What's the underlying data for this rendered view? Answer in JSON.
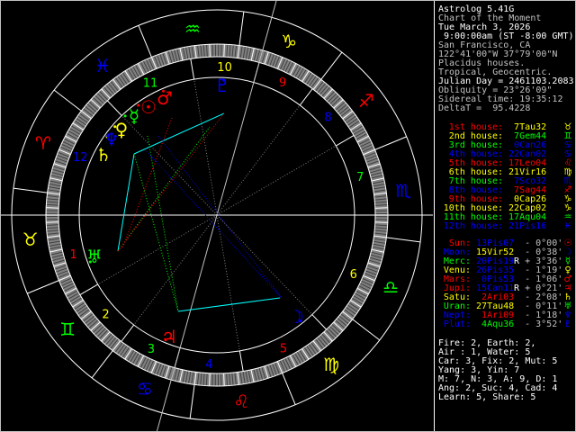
{
  "info": {
    "app_title": "Astrolog 5.41G",
    "chart_name": "Chart of the Moment",
    "date": "Tue March 3, 2026",
    "time": " 9:00:00am (ST -8:00 GMT)",
    "location": "San Francisco, CA",
    "coords": "122°41'00\"W 37°79'00\"N",
    "house_system": "Placidus houses.",
    "zodiac": "Tropical, Geocentric.",
    "julian_day": "Julian Day = 2461103.2083",
    "obliquity": "Obliquity = 23°26'09\"",
    "sidereal": "Sidereal time: 19:35:12",
    "deltat": "DeltaT =  95.4228"
  },
  "colors": {
    "fire": "#ff0000",
    "earth": "#ffff00",
    "air": "#00ff00",
    "water": "#0000ff",
    "text": "#c0c0c0",
    "white": "#ffffff",
    "aspect_cyan": "#00ffff",
    "gray": "#808080"
  },
  "houses": [
    {
      "label": "1st house:",
      "pos": " 7Tau32",
      "lcolor": "#ff0000",
      "pcolor": "#ffff00",
      "glyph": "♉"
    },
    {
      "label": "2nd house:",
      "pos": " 7Gem44",
      "lcolor": "#ffff00",
      "pcolor": "#00ff00",
      "glyph": "♊"
    },
    {
      "label": "3rd house:",
      "pos": " 0Can26",
      "lcolor": "#00ff00",
      "pcolor": "#0000ff",
      "glyph": "♋"
    },
    {
      "label": "4th house:",
      "pos": "22Can02",
      "lcolor": "#0000ff",
      "pcolor": "#0000ff",
      "glyph": "♋"
    },
    {
      "label": "5th house:",
      "pos": "17Leo04",
      "lcolor": "#ff0000",
      "pcolor": "#ff0000",
      "glyph": "♌"
    },
    {
      "label": "6th house:",
      "pos": "21Vir16",
      "lcolor": "#ffff00",
      "pcolor": "#ffff00",
      "glyph": "♍"
    },
    {
      "label": "7th house:",
      "pos": " 7Sco32",
      "lcolor": "#00ff00",
      "pcolor": "#0000ff",
      "glyph": "♏"
    },
    {
      "label": "8th house:",
      "pos": " 7Sag44",
      "lcolor": "#0000ff",
      "pcolor": "#ff0000",
      "glyph": "♐"
    },
    {
      "label": "9th house:",
      "pos": " 0Cap26",
      "lcolor": "#ff0000",
      "pcolor": "#ffff00",
      "glyph": "♑"
    },
    {
      "label": "10th house:",
      "pos": "22Cap02",
      "lcolor": "#ffff00",
      "pcolor": "#ffff00",
      "glyph": "♑"
    },
    {
      "label": "11th house:",
      "pos": "17Aqu04",
      "lcolor": "#00ff00",
      "pcolor": "#00ff00",
      "glyph": "♒"
    },
    {
      "label": "12th house:",
      "pos": "21Pis16",
      "lcolor": "#0000ff",
      "pcolor": "#0000ff",
      "glyph": "♓"
    }
  ],
  "planets": [
    {
      "name": "Sun:",
      "pos": "13Pis07",
      "retro": " ",
      "delta": "- 0°00'",
      "lcolor": "#ff0000",
      "pcolor": "#0000ff",
      "glyph": "☉",
      "lon": 343.12
    },
    {
      "name": "Moon:",
      "pos": "15Vir52",
      "retro": " ",
      "delta": "- 0°38'",
      "lcolor": "#0000ff",
      "pcolor": "#ffff00",
      "glyph": "☽",
      "lon": 165.87
    },
    {
      "name": "Merc:",
      "pos": "20Pis19",
      "retro": "R",
      "delta": "+ 3°36'",
      "lcolor": "#00ff00",
      "pcolor": "#0000ff",
      "glyph": "☿",
      "lon": 350.32
    },
    {
      "name": "Venu:",
      "pos": "26Pis35",
      "retro": " ",
      "delta": "- 1°19'",
      "lcolor": "#ffff00",
      "pcolor": "#0000ff",
      "glyph": "♀",
      "lon": 356.58
    },
    {
      "name": "Mars:",
      "pos": " 0Pis53",
      "retro": " ",
      "delta": "- 1°06'",
      "lcolor": "#ff0000",
      "pcolor": "#0000ff",
      "glyph": "♂",
      "lon": 330.88
    },
    {
      "name": "Jupi:",
      "pos": "15Can11",
      "retro": "R",
      "delta": "+ 0°21'",
      "lcolor": "#ff0000",
      "pcolor": "#0000ff",
      "glyph": "♃",
      "lon": 105.18
    },
    {
      "name": "Satu:",
      "pos": " 2Ari03",
      "retro": " ",
      "delta": "- 2°08'",
      "lcolor": "#ffff00",
      "pcolor": "#ff0000",
      "glyph": "♄",
      "lon": 2.05
    },
    {
      "name": "Uran:",
      "pos": "27Tau48",
      "retro": " ",
      "delta": "- 0°11'",
      "lcolor": "#00ff00",
      "pcolor": "#ffff00",
      "glyph": "♅",
      "lon": 57.8
    },
    {
      "name": "Nept:",
      "pos": " 1Ari09",
      "retro": " ",
      "delta": "- 1°18'",
      "lcolor": "#0000ff",
      "pcolor": "#ff0000",
      "glyph": "♆",
      "lon": 1.15
    },
    {
      "name": "Plut:",
      "pos": " 4Aqu36",
      "retro": " ",
      "delta": "- 3°52'",
      "lcolor": "#0000ff",
      "pcolor": "#00ff00",
      "glyph": "♇",
      "lon": 304.6
    }
  ],
  "summary": [
    "Fire: 2, Earth: 2,",
    "Air : 1, Water: 5",
    "Car: 3, Fix: 2, Mut: 5",
    "Yang: 3, Yin: 7",
    "M: 7, N: 3, A: 9, D: 1",
    "Ang: 2, Suc: 4, Cad: 4",
    "Learn: 5, Share: 5"
  ],
  "wheel": {
    "ascendant_lon": 37.53,
    "cusps": [
      37.53,
      67.73,
      90.43,
      112.03,
      137.07,
      171.27,
      217.53,
      247.73,
      270.43,
      292.03,
      317.07,
      351.27
    ],
    "house_numbers": [
      "1",
      "2",
      "3",
      "4",
      "5",
      "6",
      "7",
      "8",
      "9",
      "10",
      "11",
      "12"
    ],
    "signs": [
      {
        "glyph": "♈",
        "color": "#ff0000"
      },
      {
        "glyph": "♉",
        "color": "#ffff00"
      },
      {
        "glyph": "♊",
        "color": "#00ff00"
      },
      {
        "glyph": "♋",
        "color": "#0000ff"
      },
      {
        "glyph": "♌",
        "color": "#ff0000"
      },
      {
        "glyph": "♍",
        "color": "#ffff00"
      },
      {
        "glyph": "♎",
        "color": "#00ff00"
      },
      {
        "glyph": "♏",
        "color": "#0000ff"
      },
      {
        "glyph": "♐",
        "color": "#ff0000"
      },
      {
        "glyph": "♑",
        "color": "#ffff00"
      },
      {
        "glyph": "♒",
        "color": "#00ff00"
      },
      {
        "glyph": "♓",
        "color": "#0000ff"
      }
    ],
    "planet_colors": [
      "#ff0000",
      "#0000ff",
      "#00ff00",
      "#ffff00",
      "#ff0000",
      "#ff0000",
      "#ffff00",
      "#00ff00",
      "#0000ff",
      "#0000ff"
    ]
  }
}
